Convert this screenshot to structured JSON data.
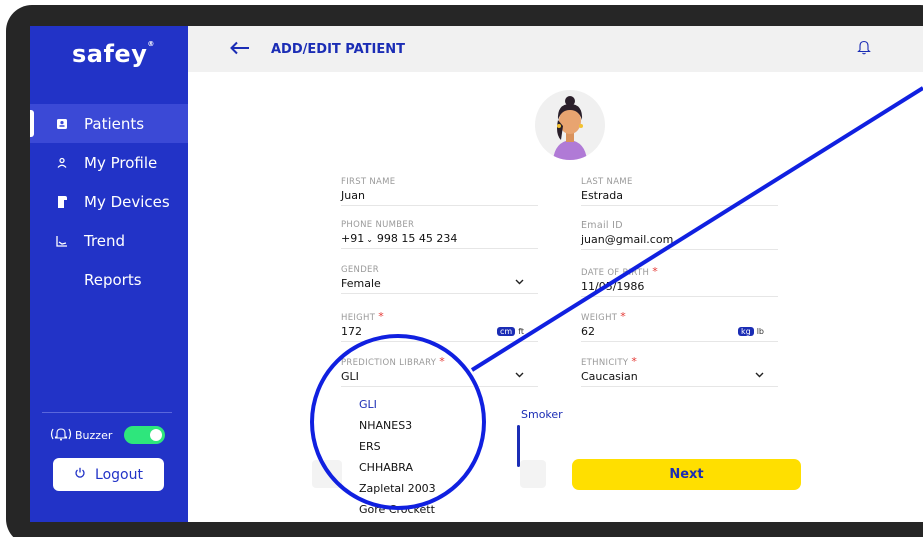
{
  "app": {
    "brand": "safey",
    "brand_mark": "®"
  },
  "sidebar": {
    "items": [
      {
        "label": "Patients",
        "icon": "id-card-icon",
        "active": true
      },
      {
        "label": "My Profile",
        "icon": "person-icon",
        "active": false
      },
      {
        "label": "My Devices",
        "icon": "device-icon",
        "active": false
      },
      {
        "label": "Trend",
        "icon": "chart-icon",
        "active": false
      },
      {
        "label": "Reports",
        "icon": "",
        "active": false
      }
    ],
    "buzzer_label": "Buzzer",
    "buzzer_on": true,
    "logout_label": "Logout"
  },
  "header": {
    "title": "ADD/EDIT PATIENT"
  },
  "form": {
    "first_name": {
      "label": "FIRST NAME",
      "value": "Juan"
    },
    "last_name": {
      "label": "LAST NAME",
      "value": "Estrada"
    },
    "phone": {
      "label": "PHONE NUMBER",
      "code": "+91",
      "value": "998 15 45 234"
    },
    "email": {
      "label": "Email ID",
      "value": "juan@gmail.com"
    },
    "gender": {
      "label": "GENDER",
      "value": "Female"
    },
    "dob": {
      "label": "DATE OF BIRTH",
      "required": "*",
      "value": "11/05/1986"
    },
    "height": {
      "label": "HEIGHT",
      "required": "*",
      "value": "172",
      "unit_on": "cm",
      "unit_off": "ft"
    },
    "weight": {
      "label": "WEIGHT",
      "required": "*",
      "value": "62",
      "unit_on": "kg",
      "unit_off": "lb"
    },
    "prediction_library": {
      "label": "PREDICTION LIBRARY",
      "required": "*",
      "value": "GLI"
    },
    "ethnicity": {
      "label": "ETHNICITY",
      "required": "*",
      "value": "Caucasian"
    },
    "smoker_label": "Smoker"
  },
  "dropdown": {
    "options": [
      "GLI",
      "NHANES3",
      "ERS",
      "CHHABRA",
      "Zapletal 2003",
      "Gore Crockett"
    ],
    "selected": "GLI"
  },
  "actions": {
    "next_label": "Next"
  },
  "colors": {
    "primary": "#2233c7",
    "accent": "#ffdf00",
    "toggle": "#2ee67c",
    "required": "#e53935",
    "annotation": "#1020e0"
  }
}
